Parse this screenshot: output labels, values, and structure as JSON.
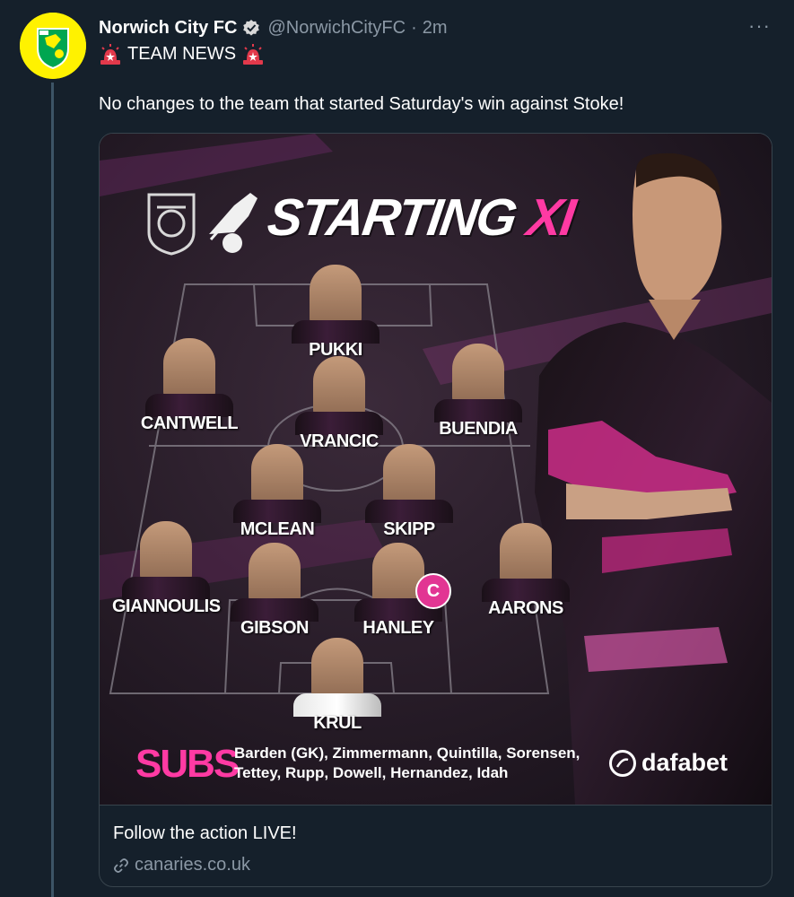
{
  "tweet": {
    "author_name": "Norwich City FC",
    "handle": "@NorwichCityFC",
    "separator": "·",
    "time": "2m",
    "more_label": "···",
    "header_line": "TEAM NEWS",
    "body": "No changes to the team that started Saturday's win against Stoke!"
  },
  "graphic": {
    "title_main": "STARTING",
    "title_accent": "XI",
    "players": [
      {
        "name": "PUKKI"
      },
      {
        "name": "CANTWELL"
      },
      {
        "name": "VRANCIC"
      },
      {
        "name": "BUENDIA"
      },
      {
        "name": "MCLEAN"
      },
      {
        "name": "SKIPP"
      },
      {
        "name": "GIANNOULIS"
      },
      {
        "name": "GIBSON"
      },
      {
        "name": "HANLEY"
      },
      {
        "name": "AARONS"
      },
      {
        "name": "KRUL"
      }
    ],
    "captain_badge": "C",
    "subs_label": "SUBS",
    "subs_line1": "Barden (GK), Zimmermann, Quintilla, Sorensen,",
    "subs_line2": "Tettey, Rupp, Dowell, Hernandez, Idah",
    "sponsor": "dafabet"
  },
  "card": {
    "title": "Follow the action LIVE!",
    "domain": "canaries.co.uk"
  },
  "colors": {
    "background": "#15202b",
    "border": "#38444d",
    "muted_text": "#8b98a5",
    "accent_pink": "#ff3aa3",
    "club_yellow": "#fff200",
    "club_green": "#00a650"
  },
  "icons": {
    "verified": "verified-badge-icon",
    "siren": "police-light-emoji",
    "link": "link-icon",
    "more": "more-options-icon"
  }
}
